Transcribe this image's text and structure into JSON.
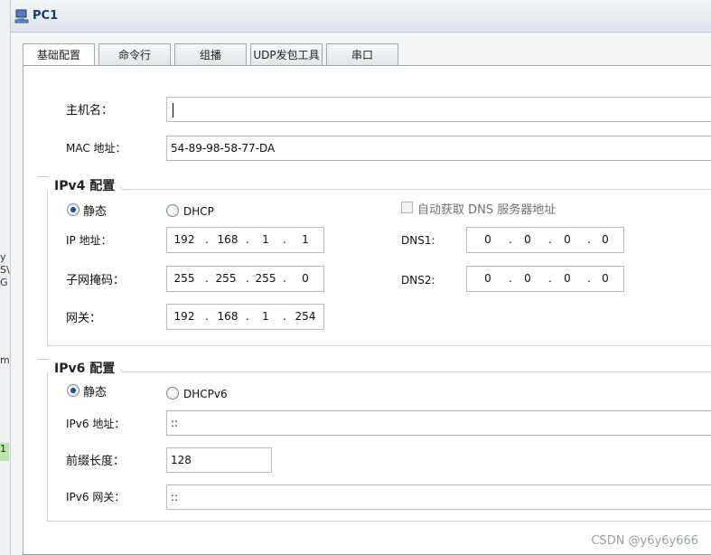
{
  "window": {
    "title": "PC1"
  },
  "tabs": [
    {
      "label": "基础配置"
    },
    {
      "label": "命令行"
    },
    {
      "label": "组播"
    },
    {
      "label": "UDP发包工具"
    },
    {
      "label": "串口"
    }
  ],
  "basic": {
    "hostname_label": "主机名：",
    "hostname_value": "",
    "mac_label": "MAC 地址：",
    "mac_value": "54-89-98-58-77-DA"
  },
  "ipv4": {
    "group_title": "IPv4 配置",
    "static_label": "静态",
    "dhcp_label": "DHCP",
    "auto_dns_label": "自动获取 DNS 服务器地址",
    "ip_label": "IP 地址：",
    "ip": [
      "192",
      "168",
      "1",
      "1"
    ],
    "mask_label": "子网掩码：",
    "mask": [
      "255",
      "255",
      "255",
      "0"
    ],
    "gateway_label": "网关：",
    "gateway": [
      "192",
      "168",
      "1",
      "254"
    ],
    "dns1_label": "DNS1:",
    "dns1": [
      "0",
      "0",
      "0",
      "0"
    ],
    "dns2_label": "DNS2:",
    "dns2": [
      "0",
      "0",
      "0",
      "0"
    ]
  },
  "ipv6": {
    "group_title": "IPv6 配置",
    "static_label": "静态",
    "dhcpv6_label": "DHCPv6",
    "ip_label": "IPv6 地址：",
    "ip_value": "::",
    "prefix_label": "前缀长度：",
    "prefix_value": "128",
    "gateway_label": "IPv6 网关：",
    "gateway_value": "::"
  },
  "background": {
    "fragments": [
      "y",
      "S\\",
      "G",
      "m",
      "1"
    ]
  },
  "watermark": "CSDN @y6y6y666",
  "colors": {
    "accent": "#1b4f8a",
    "border": "#b7bcc3",
    "panel": "#ffffff"
  }
}
